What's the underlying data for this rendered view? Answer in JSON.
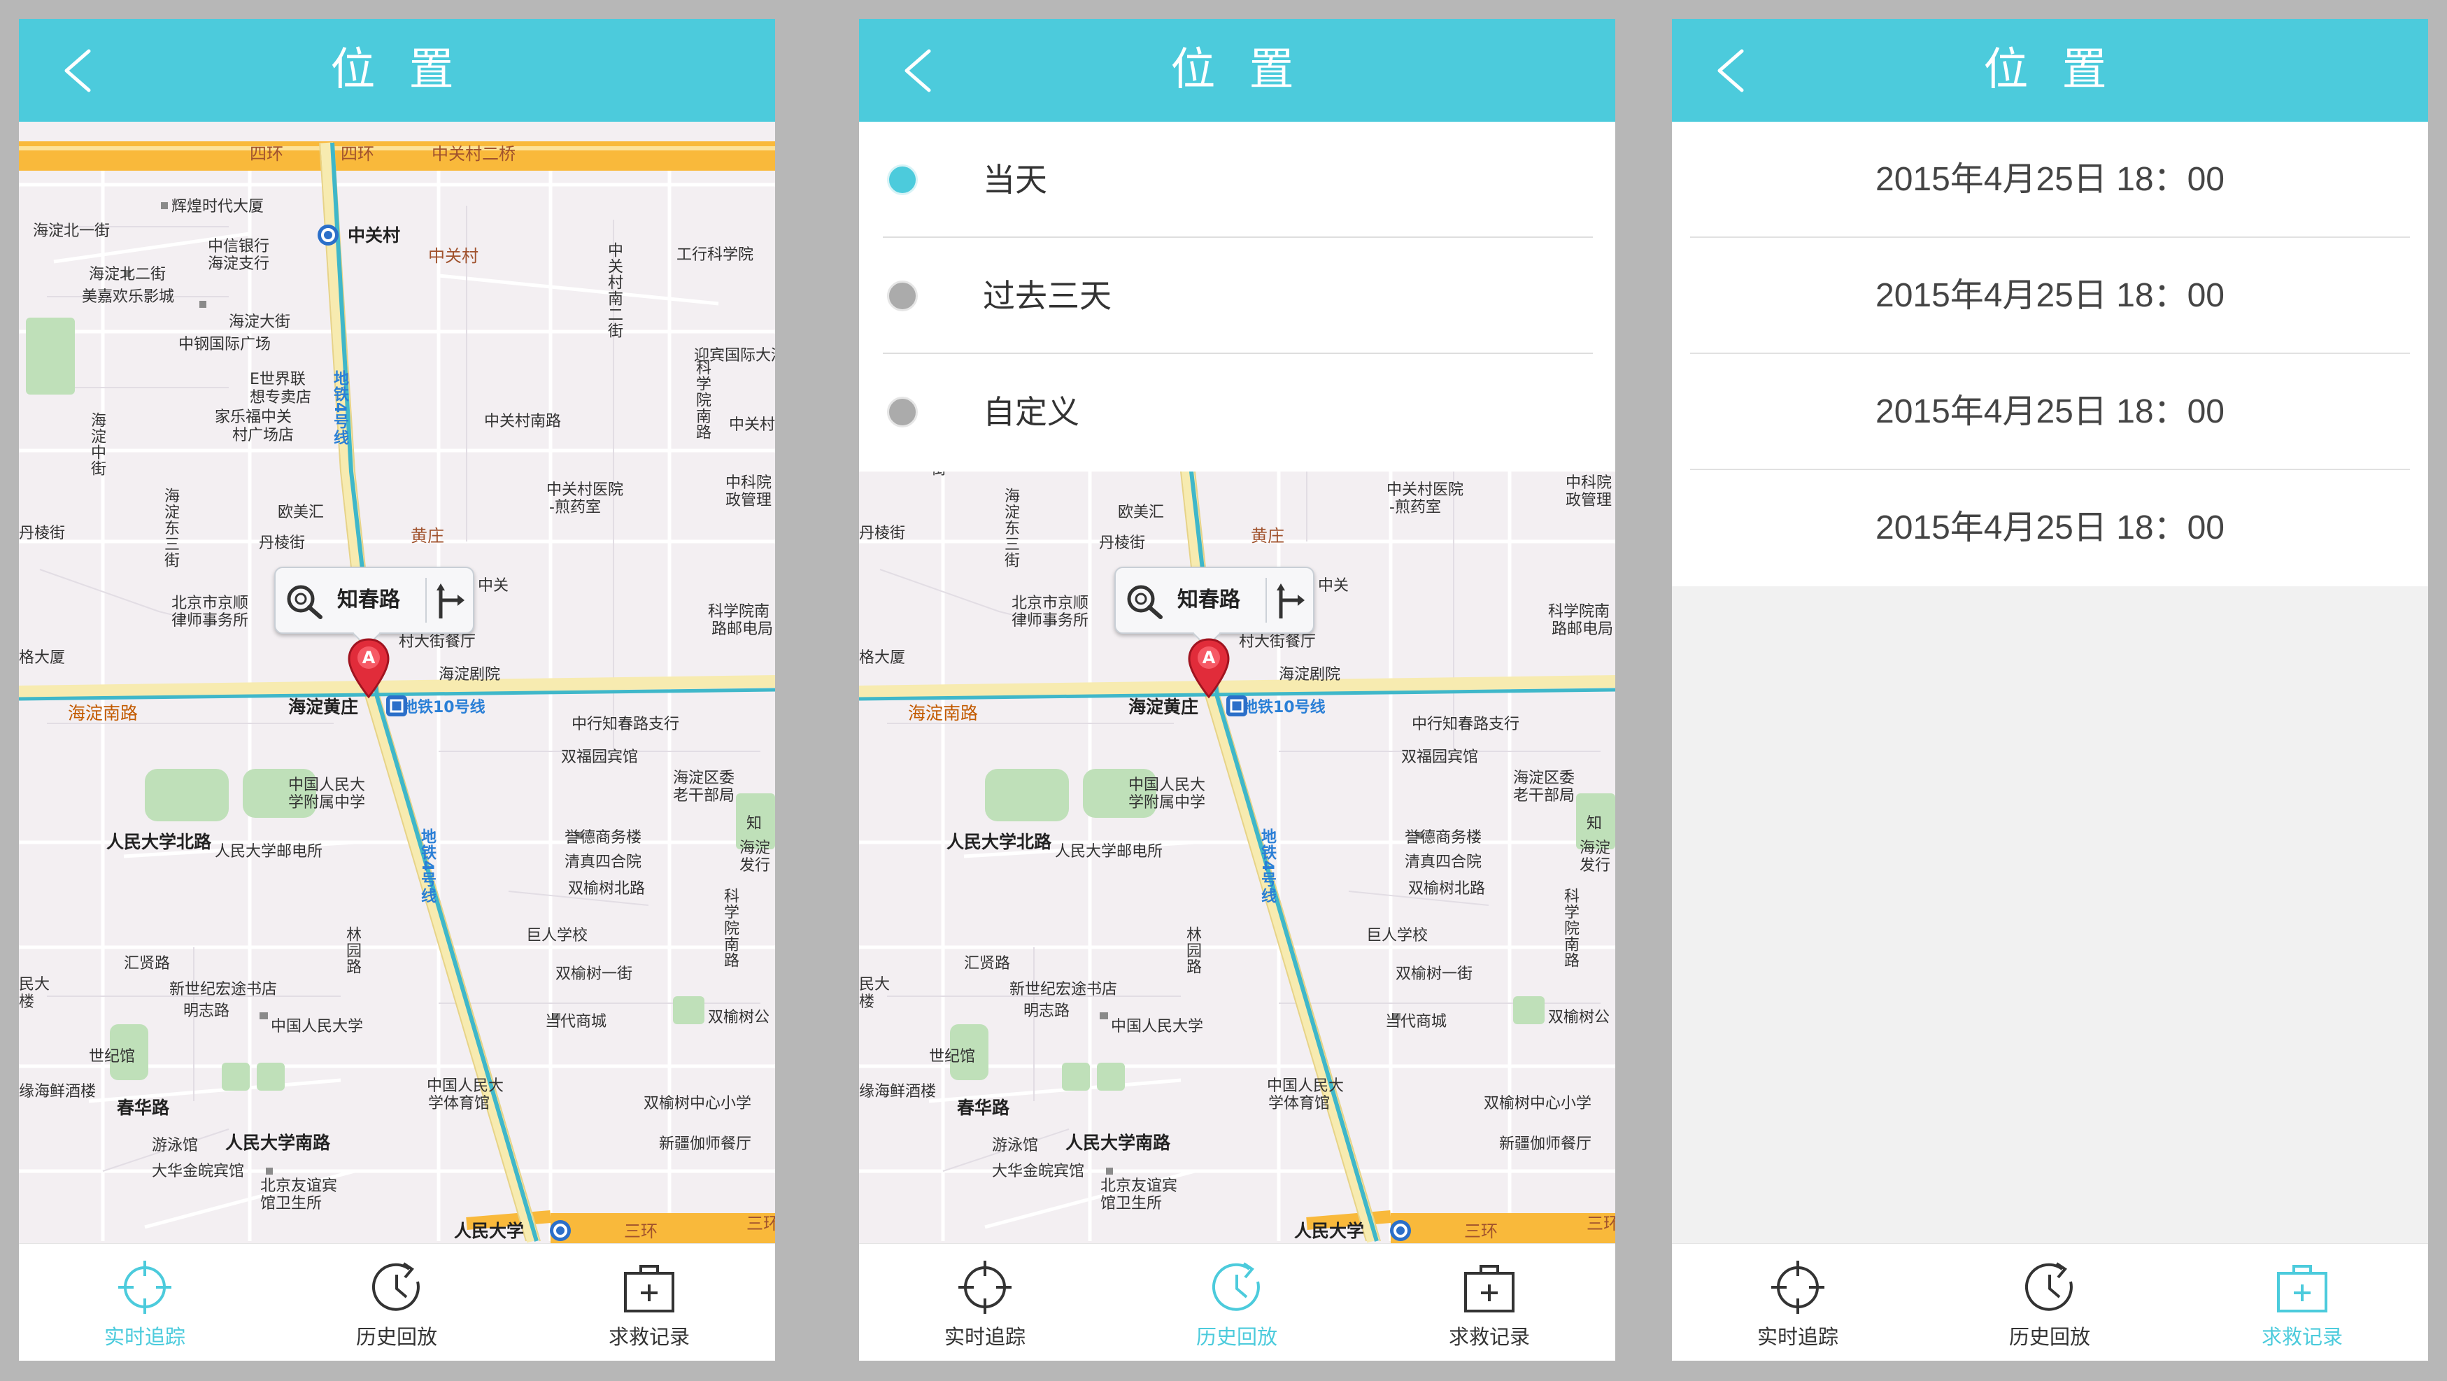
{
  "colors": {
    "accent": "#4ccbdc",
    "background": "#b7b7b7",
    "text": "#333333"
  },
  "header": {
    "title": "位 置",
    "back_icon": "chevron-left-icon"
  },
  "map_labels": {
    "ring4": "四环",
    "ring4b": "四环",
    "zhongguancun_bridge": "中关村二桥",
    "huihuang": "辉煌时代大厦",
    "haidian_north1": "海淀北一街",
    "zhongguancun_station": "中关村",
    "zhongguancun_area": "中关村",
    "bank_of_china": "中信银行",
    "bank_of_china2": "海淀支行",
    "haidian_north2": "海淀北二街",
    "meijia": "美嘉欢乐影城",
    "haidian_street": "海淀大街",
    "icbc_school": "工行科学院",
    "zhongliang": "中钢国际广场",
    "zhongguancun_south2": "中关村南二街",
    "ying_bin": "迎宾国际大酒",
    "eshijie": "E世界联",
    "xiangshi": "想专卖店",
    "jialefu": "家乐福中关",
    "cunguangchang": "村广场店",
    "line4_a": "地铁4号线",
    "zhongguancun_south_road": "中关村南路",
    "kexueyuan_nan": "科学院南路",
    "zhongguan_right": "中关村",
    "haidian_east3": "海淀东三街",
    "haidian_zhong": "海淀中街",
    "oumei": "欧美汇",
    "zhongguancun_hospital": "中关村医院",
    "hospital_pharmacy": "-煎药室",
    "zhongkeyuan": "中科院",
    "zhengzhi": "政管理",
    "danleng": "丹棱街",
    "danleng2": "丹棱街",
    "huangzhuang": "黄庄",
    "zhongguan_short": "中关",
    "beijing_jingshun": "北京市京顺",
    "lawyer": "律师事务所",
    "kexueyuan_south": "科学院南",
    "roadcomm": "路邮电局",
    "big_building": "格大厦",
    "cundajie": "村大街餐厅",
    "haidian_theater": "海淀剧院",
    "haidian_nanlu": "海淀南路",
    "haidian_huangzhuang": "海淀黄庄",
    "line10": "地铁10号线",
    "zhongxing_zhichun": "中行知春路支行",
    "shuangfu_hotel": "双福园宾馆",
    "haidian_district": "海淀区委",
    "laogan": "老干部局",
    "renda_fuzhong": "中国人民大",
    "renda_fuzhong2": "学附属中学",
    "zhi": "知",
    "renmin_university_north": "人民大学北路",
    "renda_post": "人民大学邮电所",
    "yuyi_business": "誉德商务楼",
    "qingzhen": "清真四合院",
    "haidian_district2": "海淀",
    "fahang": "发行",
    "line4_b": "地铁4号线",
    "shuangyushu_north": "双榆树北路",
    "kexueyuan_south_road": "科学院南路",
    "jurenxuexiao": "巨人学校",
    "huixian": "汇贤路",
    "linyuan": "林园路",
    "shuangyushu_1": "双榆树一街",
    "xinshiji": "新世纪宏途书店",
    "mingzhi": "明志路",
    "renmin_university": "中国人民大学",
    "dangdai": "当代商城",
    "shuangyushu_gongyuan": "双榆树公",
    "minda": "民大",
    "lou": "楼",
    "shijiguan": "世纪馆",
    "yuanhai": "缘海鲜酒楼",
    "chunhua": "春华路",
    "renda_sports": "中国人民大",
    "renda_sports2": "学体育馆",
    "shuangyushu_center": "双榆树中心小学",
    "youyongguan": "游泳馆",
    "renmin_university_south": "人民大学南路",
    "xinjiang": "新疆伽师餐厅",
    "dahua": "大华金皖宾馆",
    "beijing_friendship": "北京友谊宾",
    "guanwei": "馆卫生所",
    "renmin_university_station": "人民大学",
    "ring3": "三环",
    "ring3b": "三环"
  },
  "callout": {
    "place_name": "知春路",
    "search_icon": "search-nearby-icon",
    "route_icon": "route-icon",
    "pin_icon": "location-pin-a-icon",
    "pin_letter": "A"
  },
  "nav": {
    "items": [
      {
        "label": "实时追踪",
        "icon": "crosshair-icon"
      },
      {
        "label": "历史回放",
        "icon": "history-clock-icon"
      },
      {
        "label": "求救记录",
        "icon": "sos-kit-icon"
      }
    ],
    "active_per_screen": [
      "实时追踪",
      "历史回放",
      "求救记录"
    ]
  },
  "filter": {
    "options": [
      {
        "label": "当天",
        "selected": true
      },
      {
        "label": "过去三天",
        "selected": false
      },
      {
        "label": "自定义",
        "selected": false
      }
    ]
  },
  "records": [
    "2015年4月25日 18：00",
    "2015年4月25日 18：00",
    "2015年4月25日 18：00",
    "2015年4月25日 18：00"
  ]
}
